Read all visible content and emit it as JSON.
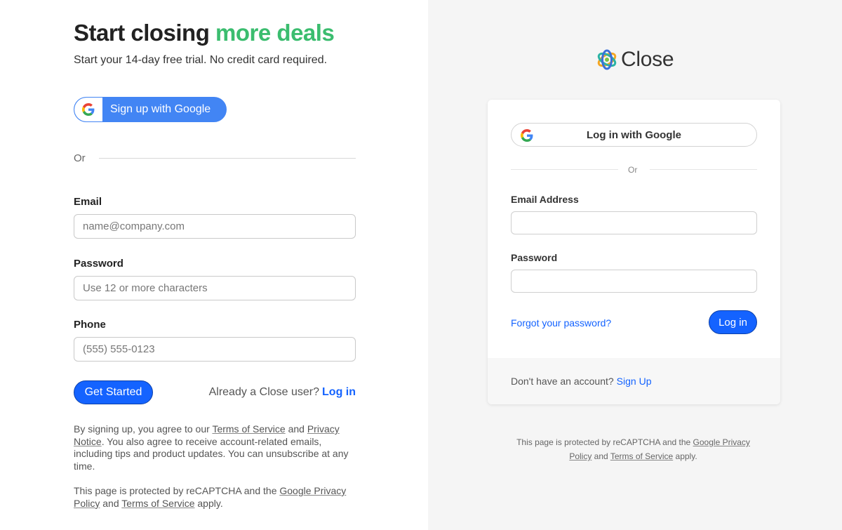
{
  "signup": {
    "headline_part1": "Start closing ",
    "headline_part2": "more deals",
    "subhead": "Start your 14-day free trial. No credit card required.",
    "google_button": "Sign up with Google",
    "or_label": "Or",
    "email_label": "Email",
    "email_placeholder": "name@company.com",
    "password_label": "Password",
    "password_placeholder": "Use 12 or more characters",
    "phone_label": "Phone",
    "phone_placeholder": "(555) 555-0123",
    "submit_label": "Get Started",
    "already_text": "Already a Close user?",
    "login_link": "Log in",
    "legal": {
      "part1": "By signing up, you agree to our ",
      "terms": "Terms of Service",
      "part2": " and ",
      "privacy": "Privacy Notice",
      "part3": ". You also agree to receive account-related emails, including tips and product updates. You can unsubscribe at any time."
    },
    "recaptcha": {
      "part1": "This page is protected by reCAPTCHA and the ",
      "google_privacy": "Google Privacy Policy",
      "part2": " and ",
      "terms": "Terms of Service",
      "part3": " apply."
    }
  },
  "login": {
    "logo_text": "Close",
    "google_button": "Log in with Google",
    "or_label": "Or",
    "email_label": "Email Address",
    "email_value": "",
    "password_label": "Password",
    "password_value": "",
    "forgot_link": "Forgot your password?",
    "submit_label": "Log in",
    "no_account_text": "Don't have an account?",
    "signup_link": "Sign Up",
    "recaptcha": {
      "part1": "This page is protected by reCAPTCHA and the ",
      "google_privacy": "Google Privacy Policy",
      "part2": " and ",
      "terms": "Terms of Service",
      "part3": " apply."
    }
  },
  "colors": {
    "accent_green": "#3bbd6f",
    "primary_blue": "#1463ff",
    "google_blue": "#4285f4",
    "right_panel_bg": "#f5f5f5"
  },
  "icons": {
    "google": "google-g-icon",
    "logo": "close-logo-icon"
  }
}
